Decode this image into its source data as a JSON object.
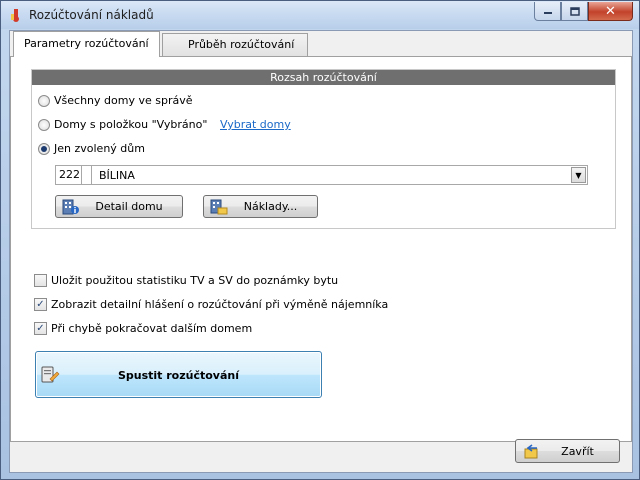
{
  "window": {
    "title": "Rozúčtování nákladů",
    "controls": {
      "minimize": "—",
      "maximize": "□",
      "close": "✕"
    }
  },
  "tabs": [
    {
      "label": "Parametry rozúčtování",
      "active": true
    },
    {
      "label": "Průběh rozúčtování",
      "active": false
    }
  ],
  "group": {
    "header": "Rozsah rozúčtování",
    "options": [
      {
        "label": "Všechny domy ve správě",
        "selected": false
      },
      {
        "label": "Domy s položkou \"Vybráno\"",
        "selected": false
      },
      {
        "label": "Jen zvolený dům",
        "selected": true
      }
    ],
    "select_houses_link": "Vybrat domy",
    "house_combo": {
      "code": "222",
      "name": "BÍLINA"
    },
    "detail_button": "Detail domu",
    "costs_button": "Náklady..."
  },
  "checks": [
    {
      "label": "Uložit použitou statistiku TV a SV do poznámky bytu",
      "checked": false
    },
    {
      "label": "Zobrazit detailní hlášení o rozúčtování při výměně nájemníka",
      "checked": true
    },
    {
      "label": "Při chybě pokračovat dalším domem",
      "checked": true
    }
  ],
  "run_button": "Spustit rozúčtování",
  "close_button": "Zavřít",
  "colors": {
    "group_header_bg": "#6f6f6f",
    "link": "#1a68c7",
    "run_button_border": "#3c7fb1"
  }
}
